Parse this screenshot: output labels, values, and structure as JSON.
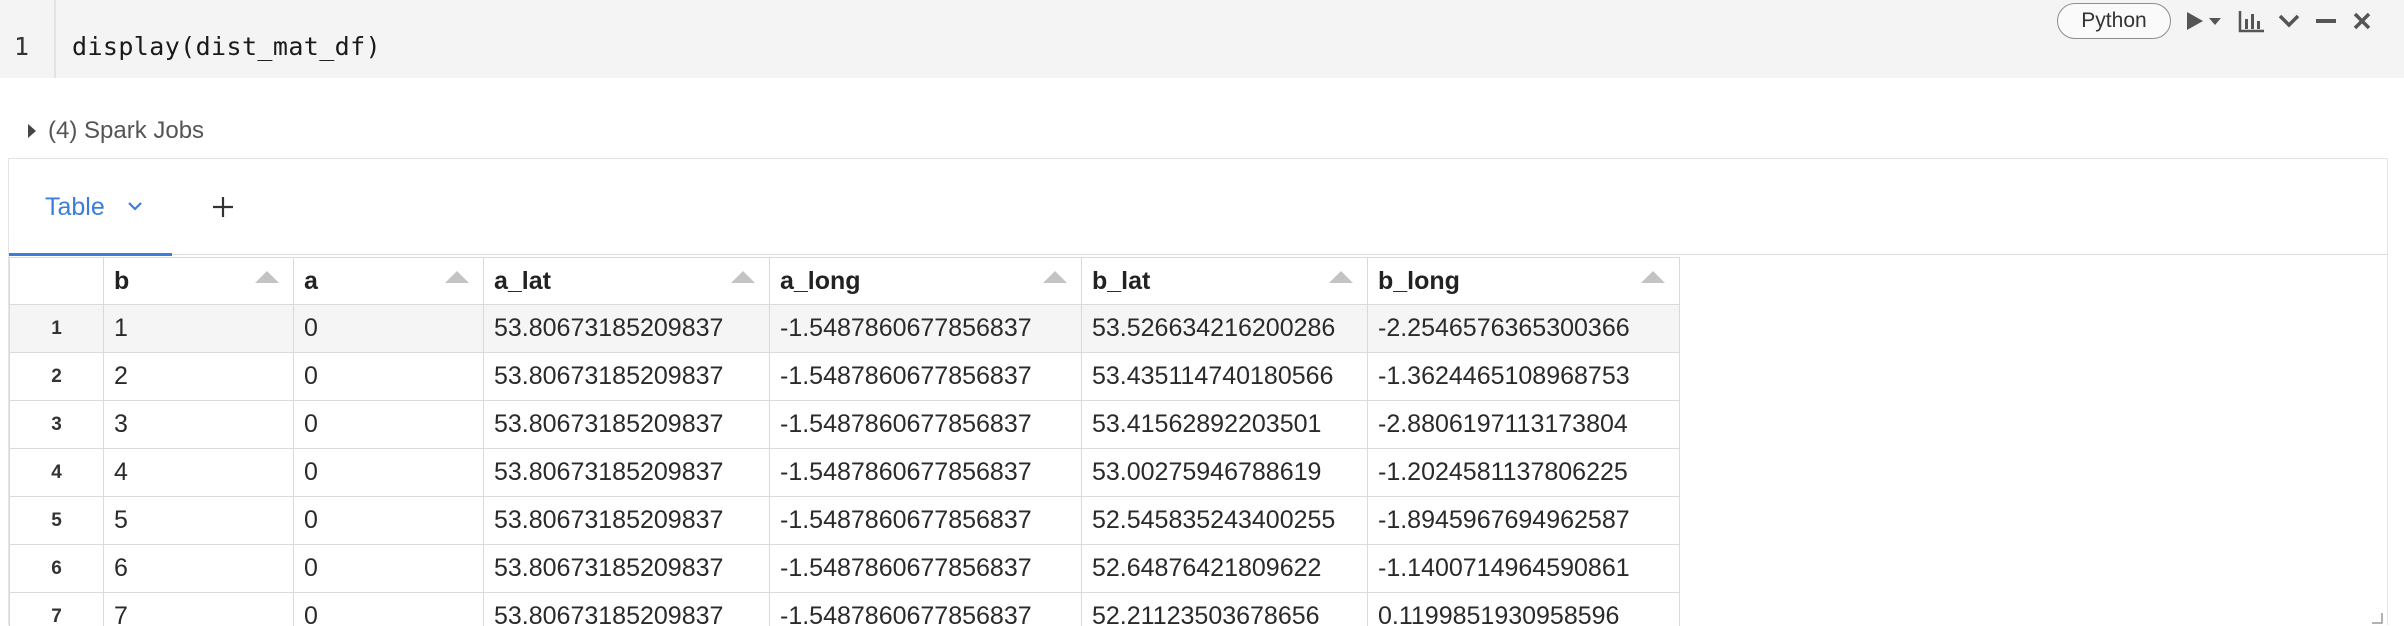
{
  "cell": {
    "line_number": "1",
    "code": "display(dist_mat_df)",
    "language": "Python",
    "toolbar_icons": [
      "run-icon",
      "run-dropdown-icon",
      "chart-icon",
      "collapse-chevron-icon",
      "minimize-icon",
      "close-icon"
    ]
  },
  "spark_jobs": {
    "label": "(4) Spark Jobs"
  },
  "result": {
    "tab_label": "Table",
    "add_tab_icon": "plus-icon",
    "columns": [
      "b",
      "a",
      "a_lat",
      "a_long",
      "b_lat",
      "b_long"
    ],
    "rows": [
      {
        "num": "1",
        "cells": [
          "1",
          "0",
          "53.80673185209837",
          "-1.5487860677856837",
          "53.526634216200286",
          "-2.2546576365300366"
        ]
      },
      {
        "num": "2",
        "cells": [
          "2",
          "0",
          "53.80673185209837",
          "-1.5487860677856837",
          "53.435114740180566",
          "-1.3624465108968753"
        ]
      },
      {
        "num": "3",
        "cells": [
          "3",
          "0",
          "53.80673185209837",
          "-1.5487860677856837",
          "53.41562892203501",
          "-2.8806197113173804"
        ]
      },
      {
        "num": "4",
        "cells": [
          "4",
          "0",
          "53.80673185209837",
          "-1.5487860677856837",
          "53.00275946788619",
          "-1.2024581137806225"
        ]
      },
      {
        "num": "5",
        "cells": [
          "5",
          "0",
          "53.80673185209837",
          "-1.5487860677856837",
          "52.545835243400255",
          "-1.8945967694962587"
        ]
      },
      {
        "num": "6",
        "cells": [
          "6",
          "0",
          "53.80673185209837",
          "-1.5487860677856837",
          "52.64876421809622",
          "-1.1400714964590861"
        ]
      },
      {
        "num": "7",
        "cells": [
          "7",
          "0",
          "53.80673185209837",
          "-1.5487860677856837",
          "52.21123503678656",
          "0.1199851930958596"
        ]
      }
    ]
  },
  "colors": {
    "accent": "#3b7ddd",
    "cell_background": "#f4f4f4",
    "grid_border": "#dadada"
  }
}
